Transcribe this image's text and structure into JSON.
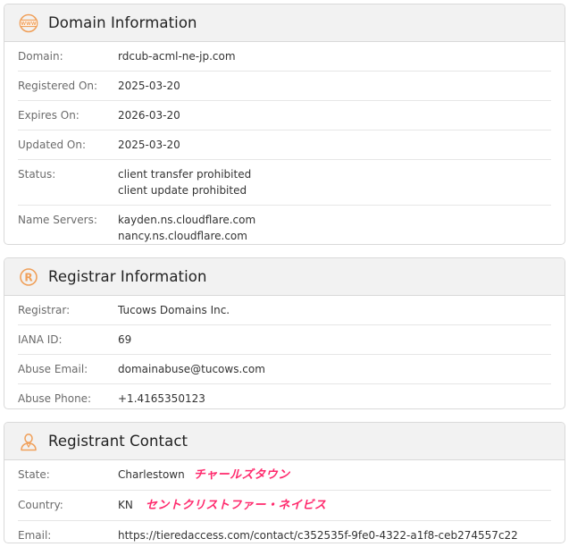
{
  "domain_info": {
    "title": "Domain Information",
    "rows": [
      {
        "label": "Domain:",
        "value": "rdcub-acml-ne-jp.com"
      },
      {
        "label": "Registered On:",
        "value": "2025-03-20"
      },
      {
        "label": "Expires On:",
        "value": "2026-03-20"
      },
      {
        "label": "Updated On:",
        "value": "2025-03-20"
      },
      {
        "label": "Status:",
        "values": [
          "client transfer prohibited",
          "client update prohibited"
        ]
      },
      {
        "label": "Name Servers:",
        "values": [
          "kayden.ns.cloudflare.com",
          "nancy.ns.cloudflare.com"
        ]
      }
    ]
  },
  "registrar_info": {
    "title": "Registrar Information",
    "rows": [
      {
        "label": "Registrar:",
        "value": "Tucows Domains Inc."
      },
      {
        "label": "IANA ID:",
        "value": "69"
      },
      {
        "label": "Abuse Email:",
        "value": "domainabuse@tucows.com"
      },
      {
        "label": "Abuse Phone:",
        "value": "+1.4165350123"
      }
    ]
  },
  "registrant_contact": {
    "title": "Registrant Contact",
    "rows": [
      {
        "label": "State:",
        "value": "Charlestown",
        "annotation": "チャールズタウン"
      },
      {
        "label": "Country:",
        "value": "KN",
        "annotation": "セントクリストファー・ネイビス"
      },
      {
        "label": "Email:",
        "value": "https://tieredaccess.com/contact/c352535f-9fe0-4322-a1f8-ceb274557c22"
      }
    ]
  },
  "colors": {
    "icon_orange": "#f0a05a",
    "annotation_pink": "#ff2a6d",
    "header_bg": "#f2f2f2"
  },
  "icons": {
    "domain": "www-globe-icon",
    "registrar": "registered-mark-icon",
    "registrant": "person-icon"
  }
}
